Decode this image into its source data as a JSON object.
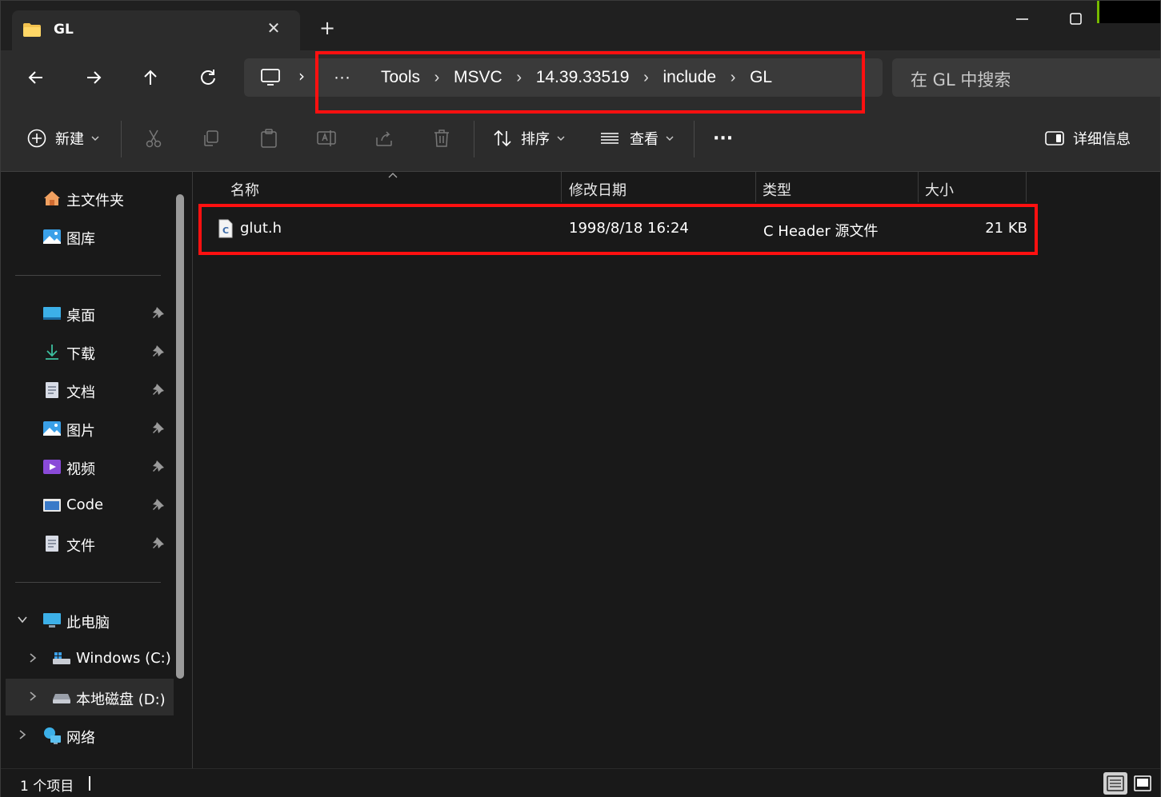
{
  "window": {
    "tab_title": "GL",
    "tab_close": "✕",
    "new_tab": "+"
  },
  "address": {
    "overflow": "···",
    "breadcrumbs": [
      "Tools",
      "MSVC",
      "14.39.33519",
      "include",
      "GL"
    ],
    "separator": "›"
  },
  "search": {
    "placeholder": "在 GL 中搜索"
  },
  "toolbar": {
    "new_label": "新建",
    "sort_label": "排序",
    "view_label": "查看",
    "more_label": "···",
    "details_label": "详细信息"
  },
  "sidebar": {
    "home": "主文件夹",
    "gallery": "图库",
    "quick_access": [
      {
        "label": "桌面",
        "icon": "desktop-icon"
      },
      {
        "label": "下载",
        "icon": "download-icon"
      },
      {
        "label": "文档",
        "icon": "document-icon"
      },
      {
        "label": "图片",
        "icon": "pictures-icon"
      },
      {
        "label": "视频",
        "icon": "videos-icon"
      },
      {
        "label": "Code",
        "icon": "folder-icon"
      },
      {
        "label": "文件",
        "icon": "document-icon"
      }
    ],
    "this_pc": "此电脑",
    "drive_c": "Windows (C:)",
    "drive_d": "本地磁盘 (D:)",
    "network": "网络"
  },
  "columns": {
    "name": "名称",
    "modified": "修改日期",
    "type": "类型",
    "size": "大小"
  },
  "files": [
    {
      "name": "glut.h",
      "modified": "1998/8/18 16:24",
      "type": "C Header 源文件",
      "size": "21 KB"
    }
  ],
  "status": {
    "count": "1 个项目"
  },
  "colors": {
    "highlight": "#ff1010",
    "accent": "#76b900",
    "folder": "#f2c24f"
  }
}
